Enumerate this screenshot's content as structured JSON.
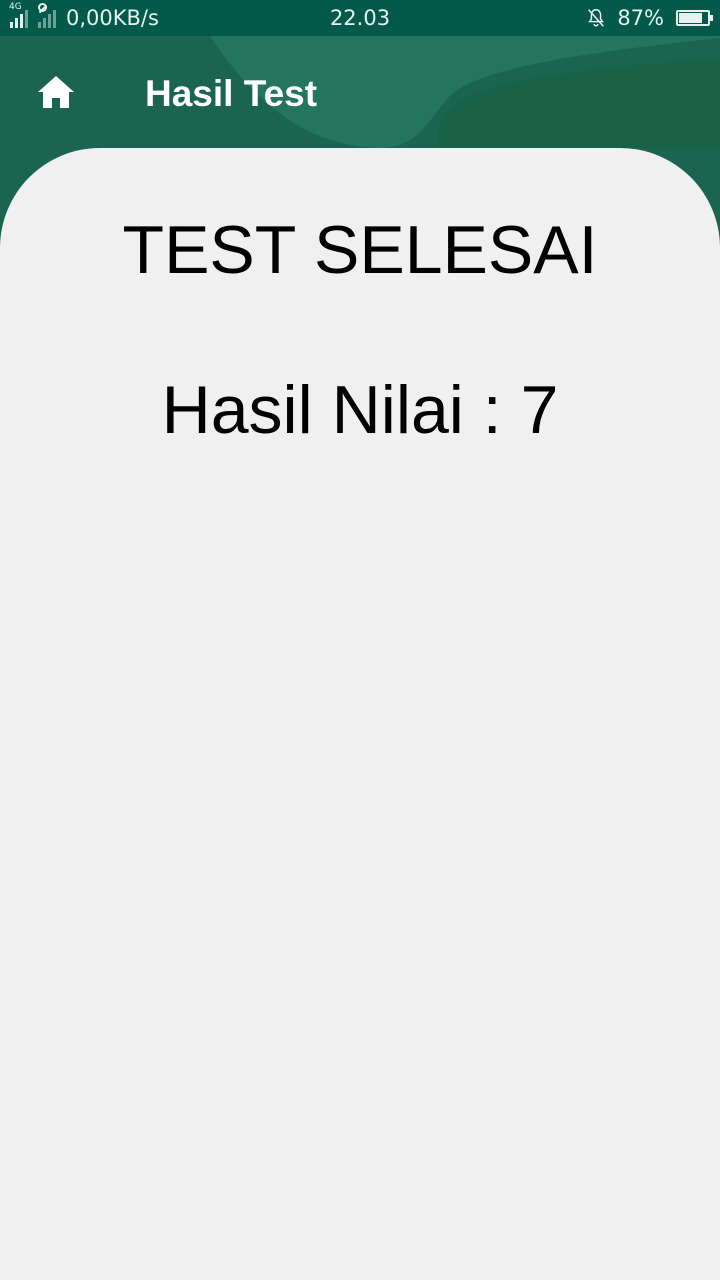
{
  "status_bar": {
    "network_label": "4G",
    "data_speed": "0,00KB/s",
    "time": "22.03",
    "battery_percent": "87%",
    "battery_level": 0.87
  },
  "app_bar": {
    "title": "Hasil Test",
    "home_icon": "home-icon"
  },
  "result": {
    "heading": "TEST SELESAI",
    "score_text": "Hasil Nilai : 7"
  },
  "colors": {
    "status_bar": "#035a4a",
    "app_bar": "#1b6450",
    "wave_light": "#23755d",
    "card_background": "#f0f0f0"
  }
}
